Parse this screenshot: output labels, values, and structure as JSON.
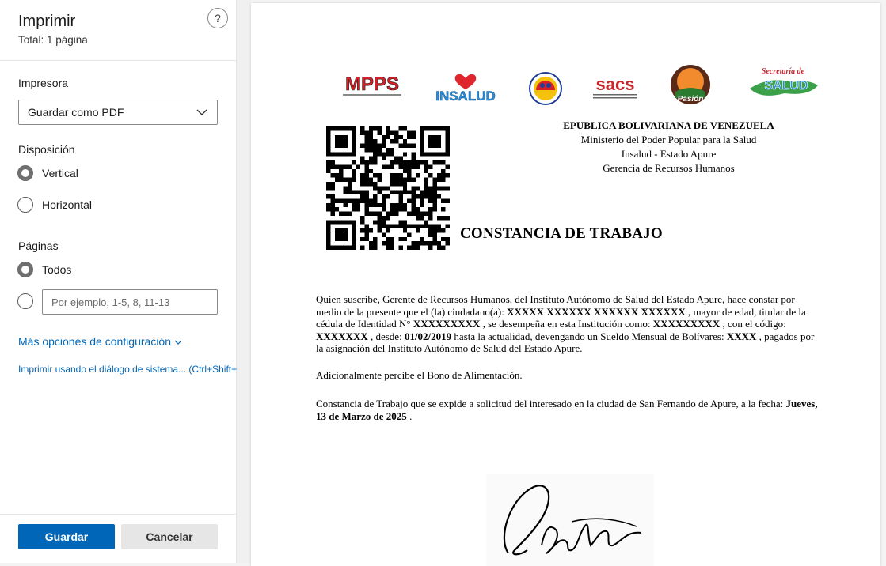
{
  "panel": {
    "title": "Imprimir",
    "subtitle": "Total: 1 página",
    "help_label": "?",
    "printer": {
      "label": "Impresora",
      "selected": "Guardar como PDF"
    },
    "layout": {
      "label": "Disposición",
      "options": [
        "Vertical",
        "Horizontal"
      ],
      "selected": "Vertical"
    },
    "pages": {
      "label": "Páginas",
      "all_label": "Todos",
      "custom_placeholder": "Por ejemplo, 1-5, 8, 11-13"
    },
    "more_settings": "Más opciones de configuración",
    "system_dialog": "Imprimir usando el diálogo de sistema... (Ctrl+Shift+P)",
    "save_button": "Guardar",
    "cancel_button": "Cancelar"
  },
  "document": {
    "logos": [
      "MPPS",
      "INSALUD",
      "SACS",
      "Pasión Apure",
      "Secretaría de Salud Apure"
    ],
    "header": {
      "line1": "EPUBLICA BOLIVARIANA DE VENEZUELA",
      "line2": "Ministerio del Poder Popular para la Salud",
      "line3": "Insalud - Estado Apure",
      "line4": "Gerencia de Recursos Humanos"
    },
    "title": "CONSTANCIA DE TRABAJO",
    "p1": {
      "t1": "Quien suscribe, Gerente de Recursos Humanos, del Instituto Autónomo de Salud del Estado Apure, hace constar por medio de la presente que el (la) ciudadano(a): ",
      "name": "XXXXX XXXXXX XXXXXX XXXXXX",
      "t2": " , mayor de edad, titular de la cédula de Identidad N° ",
      "ci": "XXXXXXXXX",
      "t3": " , se desempeña en esta Institución como: ",
      "cargo": "XXXXXXXXX",
      "t4": " , con el código: ",
      "codigo": "XXXXXXX",
      "t5": " , desde: ",
      "fecha_ingreso": "01/02/2019",
      "t6": " hasta la actualidad, devengando un Sueldo Mensual de Bolívares: ",
      "sueldo": "XXXX",
      "t7": " , pagados por la asignación del Instituto Autónomo de Salud del Estado Apure."
    },
    "p2": "Adicionalmente percibe el Bono de Alimentación.",
    "p3": {
      "t1": "Constancia de Trabajo que se expide a solicitud del interesado en la ciudad de San Fernando de Apure, a la fecha: ",
      "fecha": "Jueves, 13 de Marzo de 2025",
      "t2": " ."
    }
  }
}
